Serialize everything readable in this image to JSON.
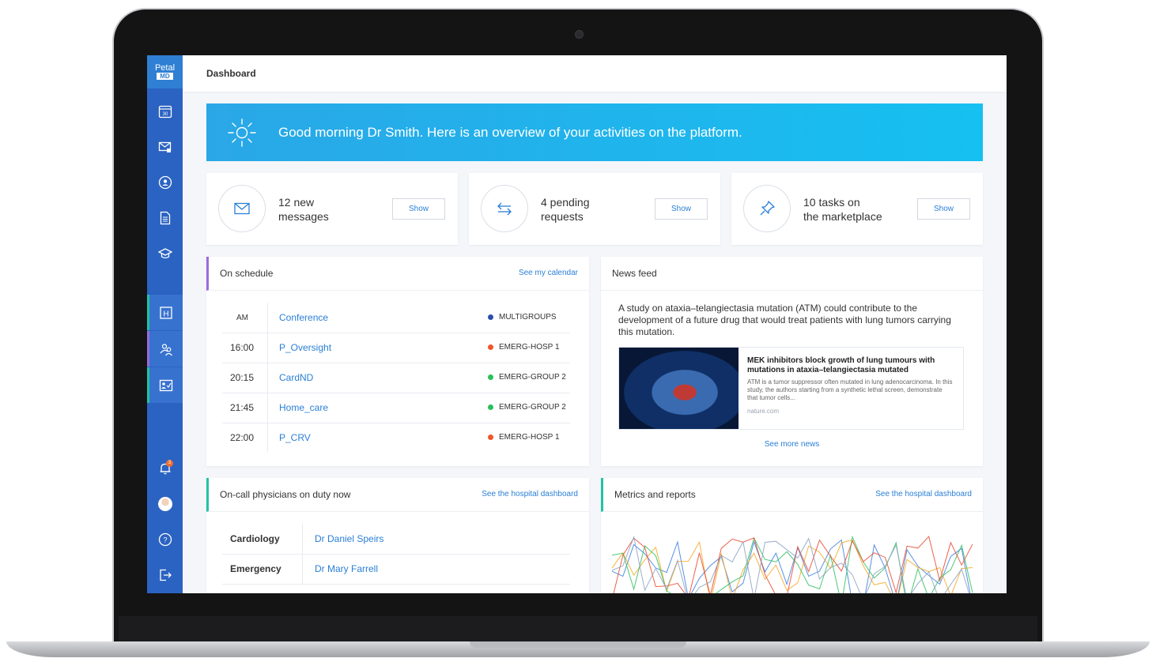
{
  "app": {
    "logo_line1": "Petal",
    "logo_line2": "MD"
  },
  "sidebar": {
    "top_items": [
      {
        "name": "calendar-icon",
        "badge": "30"
      },
      {
        "name": "secure-mail-icon"
      },
      {
        "name": "profile-icon"
      },
      {
        "name": "document-icon"
      },
      {
        "name": "education-icon"
      }
    ],
    "mid_items": [
      {
        "name": "hospital-icon"
      },
      {
        "name": "physicians-icon"
      },
      {
        "name": "reports-icon"
      }
    ],
    "bottom_items": [
      {
        "name": "bell-icon",
        "badge": "3"
      },
      {
        "name": "avatar"
      },
      {
        "name": "help-icon"
      },
      {
        "name": "logout-icon"
      }
    ]
  },
  "header": {
    "title": "Dashboard"
  },
  "banner": {
    "text": "Good morning Dr Smith. Here is an overview of your activities on the platform."
  },
  "stats": [
    {
      "line1": "12 new",
      "line2": "messages",
      "button": "Show",
      "icon": "envelope-icon"
    },
    {
      "line1": "4 pending",
      "line2": "requests",
      "button": "Show",
      "icon": "arrows-exchange-icon"
    },
    {
      "line1": "10 tasks on",
      "line2": "the marketplace",
      "button": "Show",
      "icon": "pin-icon"
    }
  ],
  "schedule": {
    "title": "On schedule",
    "link": "See my calendar",
    "rows": [
      {
        "time": "AM",
        "name": "Conference",
        "group": "MULTIGROUPS",
        "color": "#2b4fa8"
      },
      {
        "time": "16:00",
        "name": "P_Oversight",
        "group": "EMERG-HOSP 1",
        "color": "#f0562b"
      },
      {
        "time": "20:15",
        "name": "CardND",
        "group": "EMERG-GROUP 2",
        "color": "#2bbf5a"
      },
      {
        "time": "21:45",
        "name": "Home_care",
        "group": "EMERG-GROUP 2",
        "color": "#2bbf5a"
      },
      {
        "time": "22:00",
        "name": "P_CRV",
        "group": "EMERG-HOSP 1",
        "color": "#f0562b"
      }
    ]
  },
  "news": {
    "title": "News feed",
    "summary": "A study on ataxia–telangiectasia mutation (ATM) could contribute to the development of a future drug that would treat patients with lung tumors carrying this mutation.",
    "item": {
      "headline": "MEK inhibitors block growth of lung tumours with mutations in ataxia–telangiectasia mutated",
      "excerpt": "ATM is a tumor suppressor often mutated in lung adenocarcinoma. In this study, the authors starting from a synthetic lethal screen, demonstrate that tumor cells...",
      "source": "nature.com"
    },
    "more": "See more news"
  },
  "oncall": {
    "title": "On-call physicians on duty now",
    "link": "See the hospital dashboard",
    "rows": [
      {
        "dept": "Cardiology",
        "doctor": "Dr Daniel Speirs"
      },
      {
        "dept": "Emergency",
        "doctor": "Dr Mary Farrell"
      }
    ]
  },
  "metrics": {
    "title": "Metrics and reports",
    "link": "See the hospital dashboard",
    "line_colors": [
      "#3b7ddd",
      "#f5a623",
      "#2bbf5a",
      "#e8452c",
      "#8aa1c2"
    ]
  }
}
